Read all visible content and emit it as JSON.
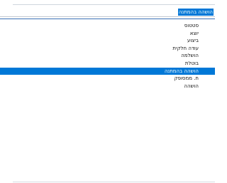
{
  "status_dropdown": {
    "selected_value": "הושהה בהמתנה"
  },
  "status_options": [
    "סטטוס",
    "יוצא",
    "ביצוע",
    "עודה חלקית",
    "הושלמה",
    "בוטלת",
    "הושהה בהמתנה",
    "ח. ממסופק",
    "הושהה"
  ],
  "selected_index": 6,
  "colors": {
    "selection": "#0078d7",
    "popup_border": "#3a6fb4"
  }
}
